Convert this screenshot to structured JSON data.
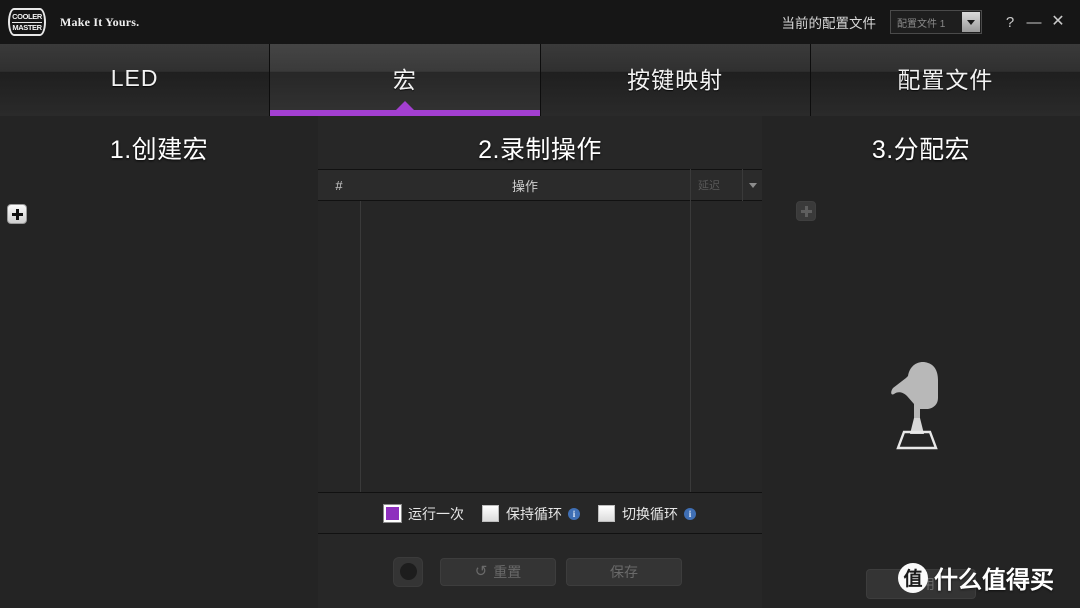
{
  "titlebar": {
    "logo_line1": "COOLER",
    "logo_line2": "MASTER",
    "tagline": "Make It Yours.",
    "profile_label": "当前的配置文件",
    "profile_value": "配置文件 1",
    "help_glyph": "?",
    "minimize_glyph": "—",
    "close_glyph": "✕"
  },
  "tabs": [
    {
      "label": "LED",
      "active": false
    },
    {
      "label": "宏",
      "active": true
    },
    {
      "label": "按键映射",
      "active": false
    },
    {
      "label": "配置文件",
      "active": false
    }
  ],
  "accent_color": "#a33fd1",
  "columns": {
    "create": {
      "title": "1.创建宏",
      "add_button": "+"
    },
    "record": {
      "title": "2.录制操作",
      "table_headers": {
        "index": "#",
        "action": "操作",
        "delay": "延迟",
        "delay_dropdown": "▼"
      },
      "rows": [],
      "loop_options": [
        {
          "label": "运行一次",
          "selected": true,
          "has_info": false
        },
        {
          "label": "保持循环",
          "selected": false,
          "has_info": true,
          "info_glyph": "i"
        },
        {
          "label": "切换循环",
          "selected": false,
          "has_info": true,
          "info_glyph": "i"
        }
      ],
      "footer": {
        "record_button": "",
        "reset_label": "重置",
        "reset_icon": "↺",
        "save_label": "保存"
      }
    },
    "assign": {
      "title": "3.分配宏",
      "add_button": "+",
      "apply_label": "应用"
    }
  },
  "watermark": {
    "badge": "值",
    "text": "什么值得买"
  }
}
